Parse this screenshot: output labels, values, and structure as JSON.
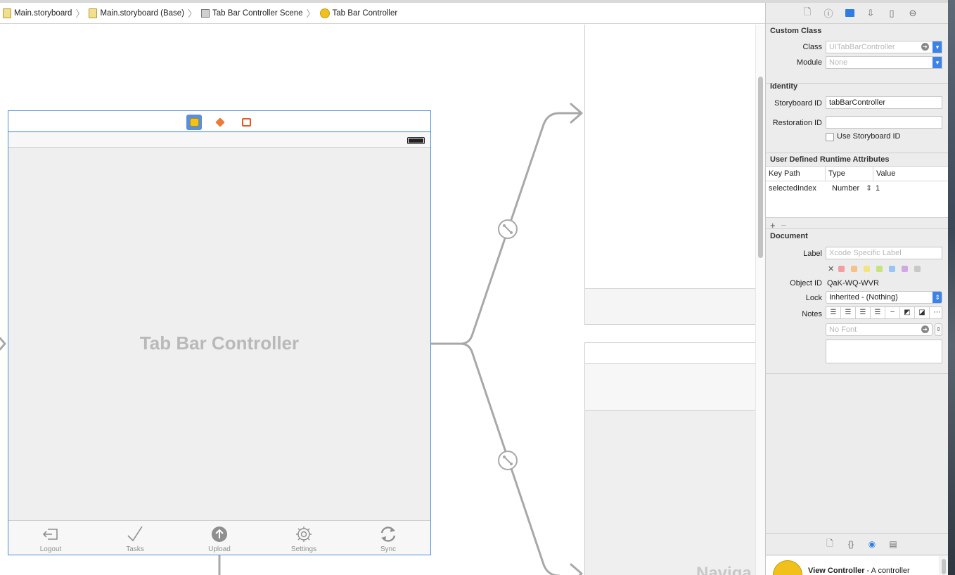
{
  "breadcrumbs": [
    "Main.storyboard",
    "Main.storyboard (Base)",
    "Tab Bar Controller Scene",
    "Tab Bar Controller"
  ],
  "scene": {
    "title": "Tab Bar Controller",
    "tabs": [
      {
        "label": "Logout",
        "icon": "logout-icon"
      },
      {
        "label": "Tasks",
        "icon": "checkmark-icon"
      },
      {
        "label": "Upload",
        "icon": "upload-icon"
      },
      {
        "label": "Settings",
        "icon": "gear-icon"
      },
      {
        "label": "Sync",
        "icon": "sync-icon"
      }
    ]
  },
  "second_scene": {
    "title_fragment": "Naviga"
  },
  "inspector": {
    "custom_class": {
      "title": "Custom Class",
      "class_label": "Class",
      "class_placeholder": "UITabBarController",
      "module_label": "Module",
      "module_placeholder": "None"
    },
    "identity": {
      "title": "Identity",
      "storyboard_id_label": "Storyboard ID",
      "storyboard_id_value": "tabBarController",
      "restoration_id_label": "Restoration ID",
      "restoration_id_value": "",
      "use_storyboard_id_label": "Use Storyboard ID"
    },
    "udra": {
      "title": "User Defined Runtime Attributes",
      "columns": [
        "Key Path",
        "Type",
        "Value"
      ],
      "rows": [
        {
          "key_path": "selectedIndex",
          "type": "Number",
          "value": "1"
        }
      ]
    },
    "document": {
      "title": "Document",
      "label_label": "Label",
      "label_placeholder": "Xcode Specific Label",
      "object_id_label": "Object ID",
      "object_id_value": "QaK-WQ-WVR",
      "lock_label": "Lock",
      "lock_value": "Inherited - (Nothing)",
      "notes_label": "Notes",
      "font_placeholder": "No Font",
      "label_colors": [
        "#f0a0a0",
        "#f5c28a",
        "#f2e47e",
        "#c8e27f",
        "#9cc4f2",
        "#d3a7e4",
        "#c8c8c8"
      ]
    },
    "library": {
      "item_title": "View Controller",
      "item_subtitle": " - A controller"
    }
  },
  "colors": {
    "accent": "#2f7de1",
    "scene_border": "#4a90d9"
  }
}
